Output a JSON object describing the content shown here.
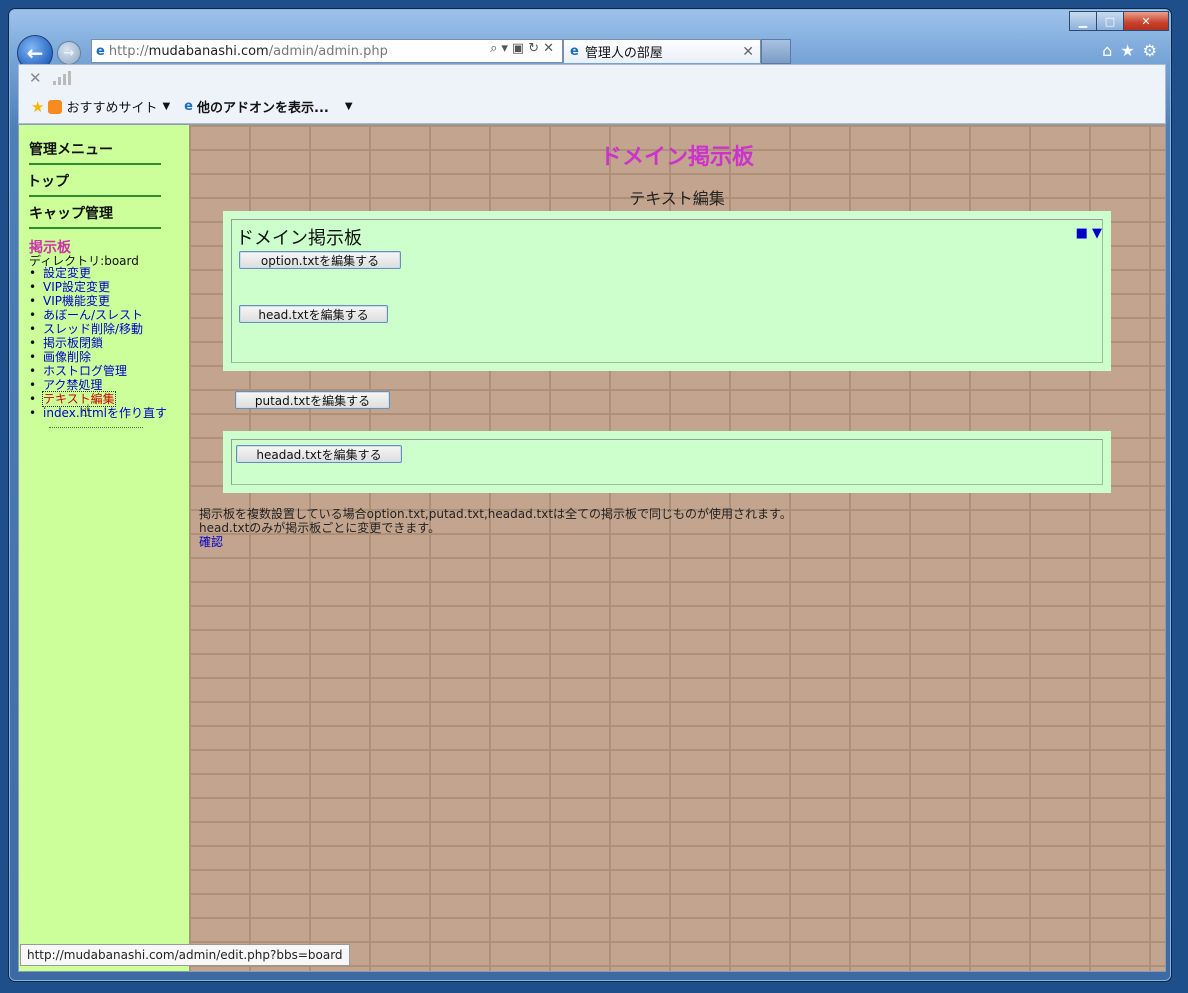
{
  "browser": {
    "address": {
      "prefix": "http://",
      "host": "mudabanashi.com",
      "path": "/admin/admin.php"
    },
    "tab": {
      "title": "管理人の部屋"
    },
    "favorites": {
      "item1": "おすすめサイト",
      "item2": "他のアドオンを表示..."
    }
  },
  "sidebar": {
    "menu_admin": "管理メニュー",
    "top": "トップ",
    "cap": "キャップ管理",
    "bbs_title": "掲示板",
    "directory": "ディレクトリ:board",
    "items": [
      {
        "label": "設定変更"
      },
      {
        "label": "VIP設定変更"
      },
      {
        "label": "VIP機能変更"
      },
      {
        "label": "あぼーん/スレスト"
      },
      {
        "label": "スレッド削除/移動"
      },
      {
        "label": "掲示板閉鎖"
      },
      {
        "label": "画像削除"
      },
      {
        "label": "ホストログ管理"
      },
      {
        "label": "アク禁処理"
      },
      {
        "label": "テキスト編集"
      },
      {
        "label": "index.htmlを作り直す"
      }
    ]
  },
  "main": {
    "title": "ドメイン掲示板",
    "subtitle": "テキスト編集",
    "panel_heading": "ドメイン掲示板",
    "panel_arrows": "■ ▼",
    "buttons": {
      "option": "option.txtを編集する",
      "head": "head.txtを編集する",
      "putad": "putad.txtを編集する",
      "headad": "headad.txtを編集する"
    },
    "note_line1": "掲示板を複数設置している場合option.txt,putad.txt,headad.txtは全ての掲示板で同じものが使用されます。",
    "note_line2": "head.txtのみが掲示板ごとに変更できます。",
    "confirm_link": "確認"
  },
  "status_url": "http://mudabanashi.com/admin/edit.php?bbs=board",
  "colors": {
    "sidebar_bg": "#ccff99",
    "panel_bg": "#ccffcc",
    "title": "#cc33cc",
    "link": "#0000cc"
  }
}
